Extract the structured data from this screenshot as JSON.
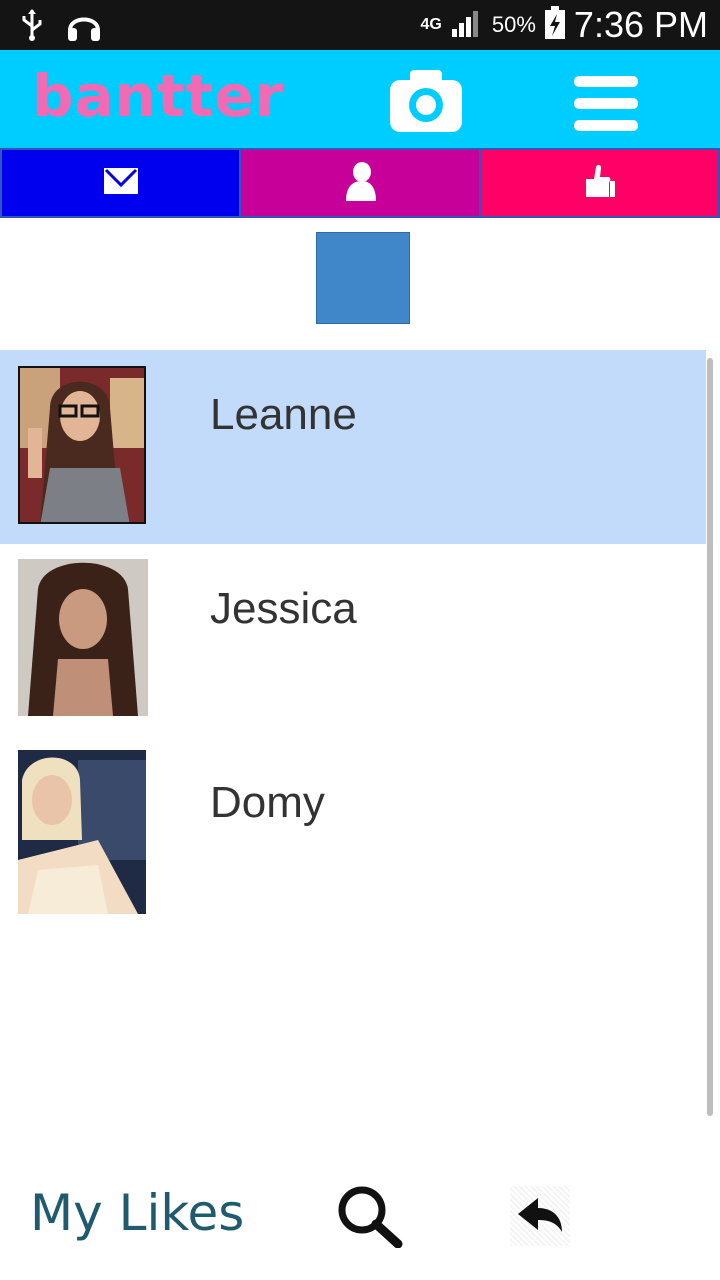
{
  "status_bar": {
    "network": "4G",
    "battery": "50%",
    "time": "7:36 PM",
    "icons": [
      "usb-icon",
      "headphones-icon",
      "signal-icon",
      "battery-charging-icon"
    ]
  },
  "header": {
    "logo": "bantter",
    "accent_color": "#00cdff",
    "logo_color": "#f26ab4",
    "icons": [
      "camera-icon",
      "menu-icon"
    ]
  },
  "tabs": [
    {
      "icon": "envelope-icon",
      "color": "#0000ee"
    },
    {
      "icon": "person-icon",
      "color": "#c8009a"
    },
    {
      "icon": "thumbs-up-icon",
      "color": "#ff0066"
    }
  ],
  "list": {
    "items": [
      {
        "name": "Leanne",
        "selected": true
      },
      {
        "name": "Jessica",
        "selected": false
      },
      {
        "name": "Domy",
        "selected": false
      }
    ]
  },
  "bottom_bar": {
    "my_likes_label": "My Likes",
    "icons": [
      "search-icon",
      "reply-arrow-icon"
    ]
  }
}
